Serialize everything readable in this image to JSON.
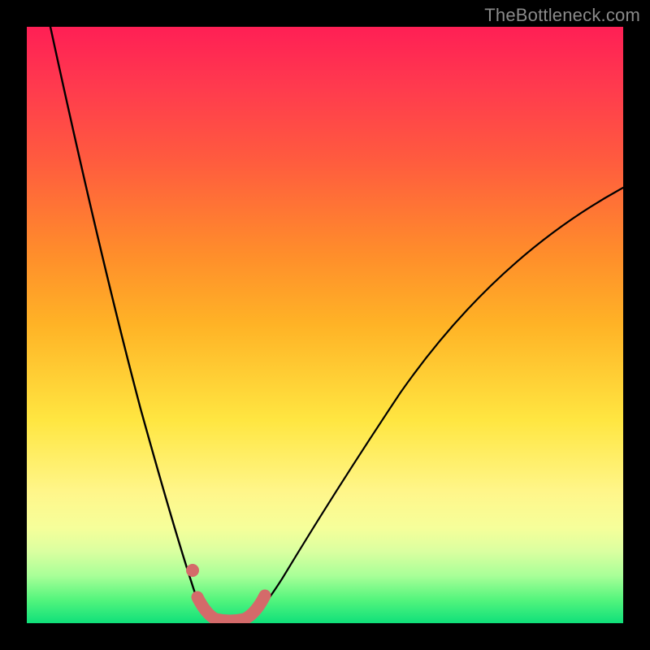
{
  "watermark": "TheBottleneck.com",
  "colors": {
    "page_bg": "#000000",
    "curve_stroke": "#000000",
    "marker_stroke": "#d46a6a",
    "marker_fill": "#d46a6a",
    "gradient_stops": [
      "#ff1f55",
      "#ff3a4e",
      "#ff5a3f",
      "#ff8d2b",
      "#ffb326",
      "#ffe641",
      "#fff68a",
      "#f6ff9a",
      "#daffa0",
      "#a9ff98",
      "#55f57d",
      "#0fe07a"
    ]
  },
  "chart_data": {
    "type": "line",
    "title": "",
    "xlabel": "",
    "ylabel": "",
    "xlim": [
      0,
      100
    ],
    "ylim": [
      0,
      100
    ],
    "grid": false,
    "series": [
      {
        "name": "left-branch",
        "x": [
          4,
          6,
          8,
          10,
          12,
          14,
          16,
          18,
          20,
          22,
          24,
          26,
          27,
          28,
          29,
          30,
          31
        ],
        "y": [
          100,
          90,
          80,
          70,
          61,
          52,
          44,
          36,
          29,
          22,
          16,
          10,
          7,
          5,
          3,
          1.5,
          0.5
        ]
      },
      {
        "name": "right-branch",
        "x": [
          37,
          38,
          40,
          42,
          45,
          48,
          52,
          56,
          60,
          65,
          70,
          76,
          82,
          88,
          94,
          100
        ],
        "y": [
          0.5,
          1.5,
          4,
          7,
          12,
          17,
          23,
          29,
          35,
          41,
          47,
          53,
          59,
          64,
          69,
          73
        ]
      },
      {
        "name": "flat-bottom",
        "x": [
          29,
          31,
          33,
          35,
          37
        ],
        "y": [
          2,
          0.5,
          0.2,
          0.5,
          2
        ]
      }
    ],
    "markers": [
      {
        "name": "left-knee-dot",
        "x": 27.8,
        "y": 8.8
      },
      {
        "name": "bottom-highlight-stroke",
        "from_x": 29,
        "to_x": 38,
        "y_approx": 1.5
      }
    ],
    "notes": "Axes are unlabeled in the source image; x and y expressed as 0–100 percent of the visible plot rectangle. y=0 is the bottom (green) edge, y=100 is the top (red) edge. Values estimated from pixel positions."
  }
}
